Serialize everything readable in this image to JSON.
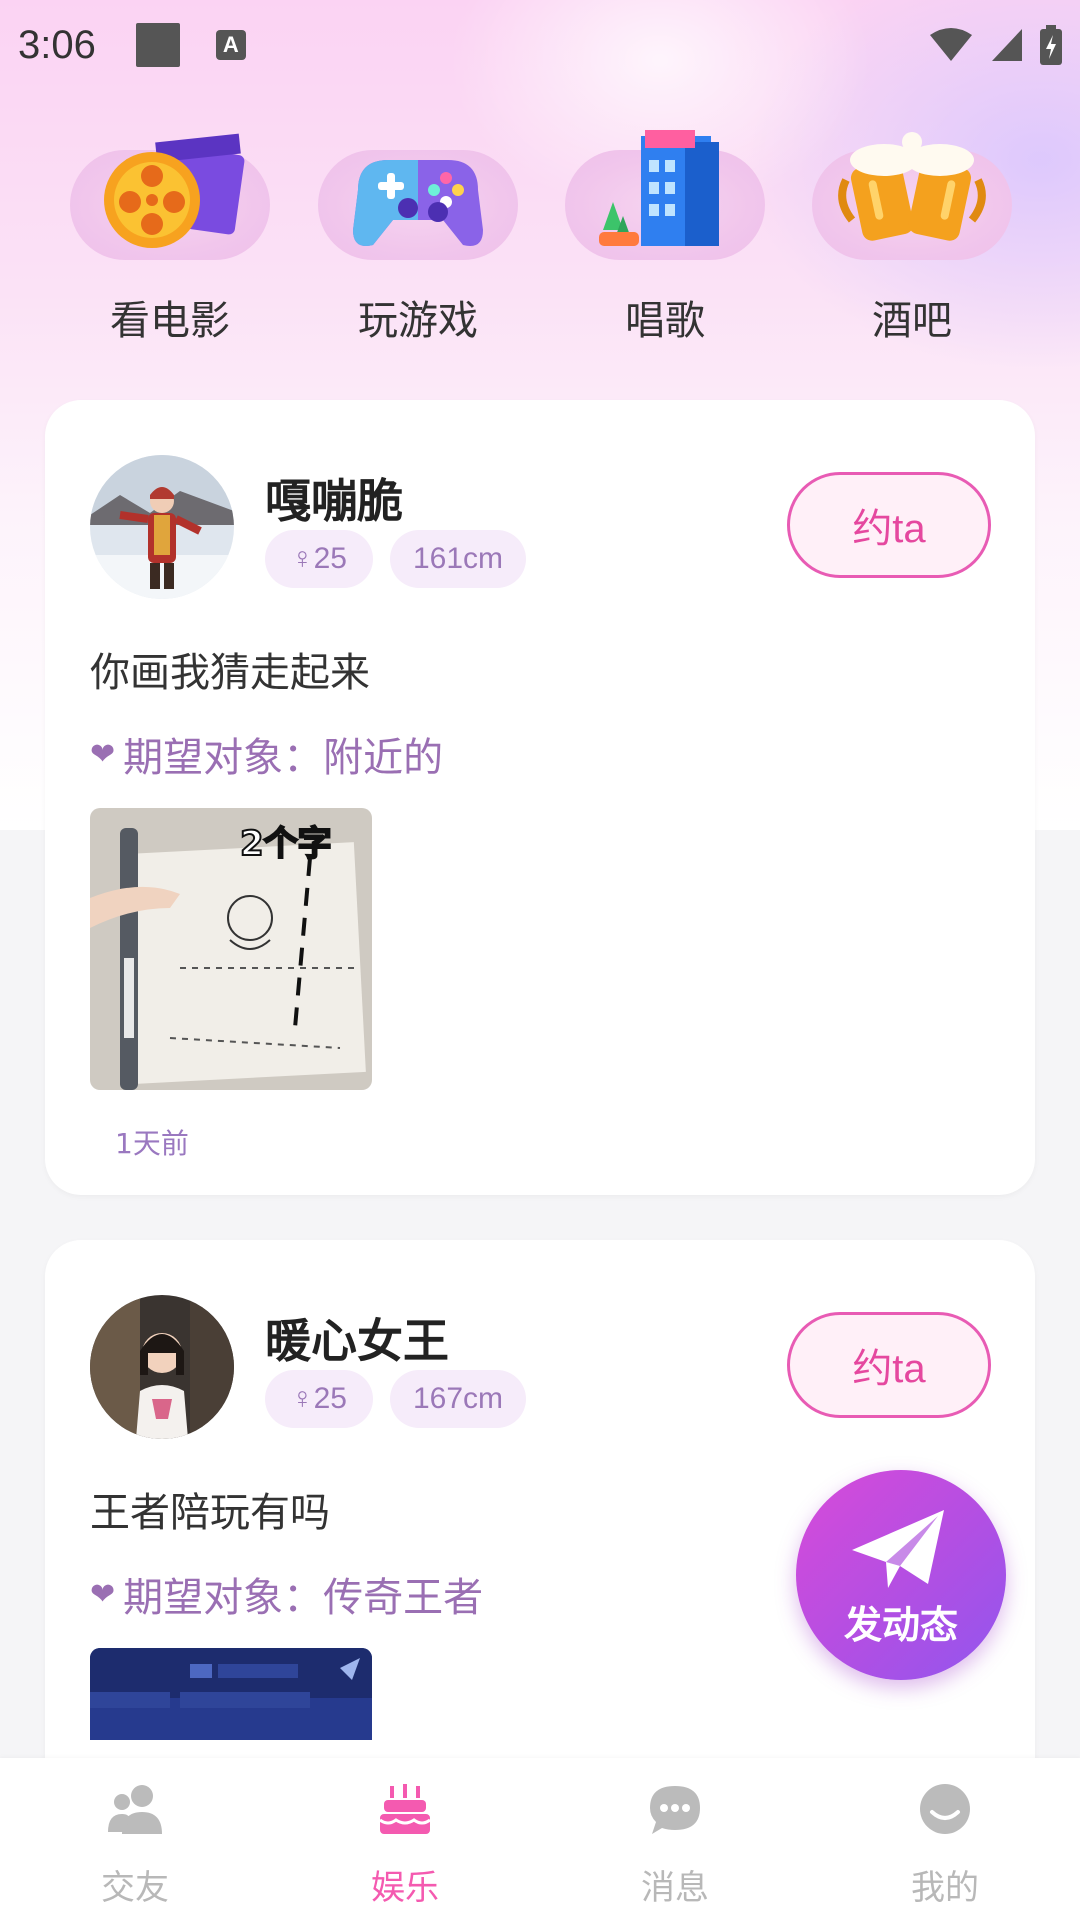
{
  "status_bar": {
    "time": "3:06",
    "a_icon_text": "A"
  },
  "categories": [
    {
      "label": "看电影",
      "icon": "movie-reel-icon"
    },
    {
      "label": "玩游戏",
      "icon": "gamepad-icon"
    },
    {
      "label": "唱歌",
      "icon": "hotel-building-icon"
    },
    {
      "label": "酒吧",
      "icon": "beer-mugs-icon"
    }
  ],
  "posts": [
    {
      "name": "嘎嘣脆",
      "age": "♀25",
      "height": "161cm",
      "button": "约ta",
      "text": "你画我猜走起来",
      "expect": "期望对象：附近的",
      "photo_caption": "2个字",
      "time": "1天前"
    },
    {
      "name": "暖心女王",
      "age": "♀25",
      "height": "167cm",
      "button": "约ta",
      "text": "王者陪玩有吗",
      "expect": "期望对象：传奇王者"
    }
  ],
  "fab": {
    "label": "发动态"
  },
  "nav": [
    {
      "label": "交友",
      "icon": "friends-icon"
    },
    {
      "label": "娱乐",
      "icon": "cake-icon",
      "active": true
    },
    {
      "label": "消息",
      "icon": "chat-bubble-icon"
    },
    {
      "label": "我的",
      "icon": "smiley-icon"
    }
  ],
  "colors": {
    "accent": "#f45ab0",
    "purple": "#9a6fb3",
    "fab": "#b24fe3"
  }
}
